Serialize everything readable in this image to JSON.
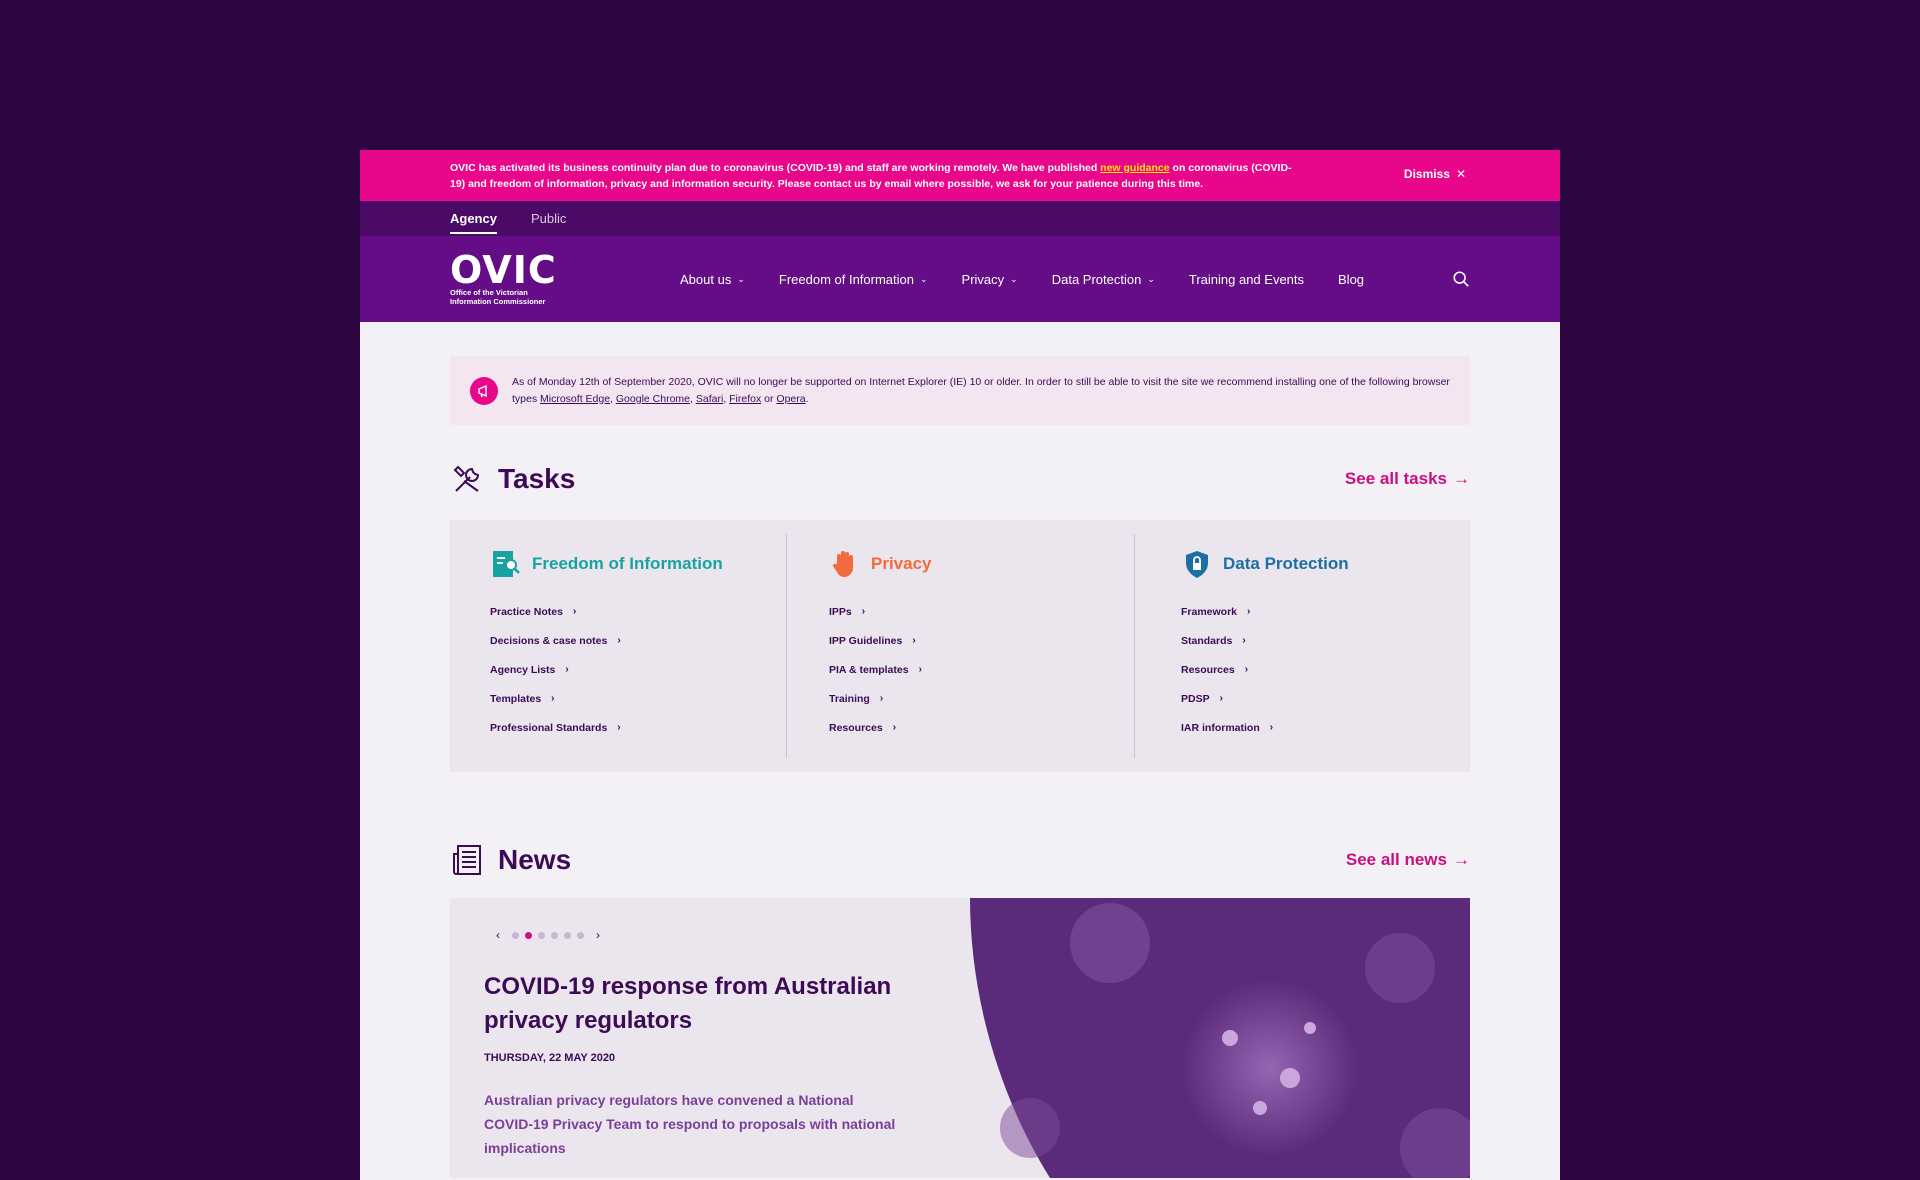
{
  "alert": {
    "text_before": "OVIC has activated its business continuity plan due to coronavirus (COVID-19) and staff are working remotely. We have published ",
    "link": "new guidance",
    "text_after": " on coronavirus (COVID-19) and freedom of information, privacy and information security. Please contact us by email where possible, we ask for your patience during this time.",
    "dismiss": "Dismiss"
  },
  "audience": {
    "tabs": [
      "Agency",
      "Public"
    ],
    "active": "Agency"
  },
  "logo": {
    "mark": "OVIC",
    "subtitle_line1": "Office of the Victorian",
    "subtitle_line2": "Information Commissioner"
  },
  "nav": {
    "items": [
      "About us",
      "Freedom of Information",
      "Privacy",
      "Data Protection",
      "Training and Events",
      "Blog"
    ]
  },
  "notice": {
    "text_before": "As of Monday 12th of September 2020, OVIC will no longer be supported on Internet Explorer (IE) 10 or older. In order to still be able to visit the site we recommend installing one of the following browser types ",
    "browsers": [
      "Microsoft Edge",
      "Google Chrome",
      "Safari",
      "Firefox",
      "Opera"
    ],
    "sep1": ", ",
    "sep2": ", ",
    "sep3": ", ",
    "sep4": " or ",
    "end": "."
  },
  "tasks": {
    "title": "Tasks",
    "see_all": "See all tasks",
    "columns": [
      {
        "title": "Freedom of Information",
        "color": "#17a3a1",
        "items": [
          "Practice Notes",
          "Decisions & case notes",
          "Agency Lists",
          "Templates",
          "Professional Standards"
        ]
      },
      {
        "title": "Privacy",
        "color": "#f26a3d",
        "items": [
          "IPPs",
          "IPP Guidelines",
          "PIA & templates",
          "Training",
          "Resources"
        ]
      },
      {
        "title": "Data Protection",
        "color": "#1d6fa3",
        "items": [
          "Framework",
          "Standards",
          "Resources",
          "PDSP",
          "IAR information"
        ]
      }
    ]
  },
  "news": {
    "title": "News",
    "see_all": "See all news",
    "article": {
      "title": "COVID-19 response from Australian privacy regulators",
      "date": "THURSDAY, 22 MAY 2020",
      "summary": "Australian privacy regulators have convened a National COVID-19 Privacy Team to respond to proposals with national implications"
    },
    "carousel": {
      "count": 6,
      "active": 2
    }
  },
  "colors": {
    "accent": "#c8107f",
    "brand": "#650d86",
    "alert": "#e8068a"
  }
}
